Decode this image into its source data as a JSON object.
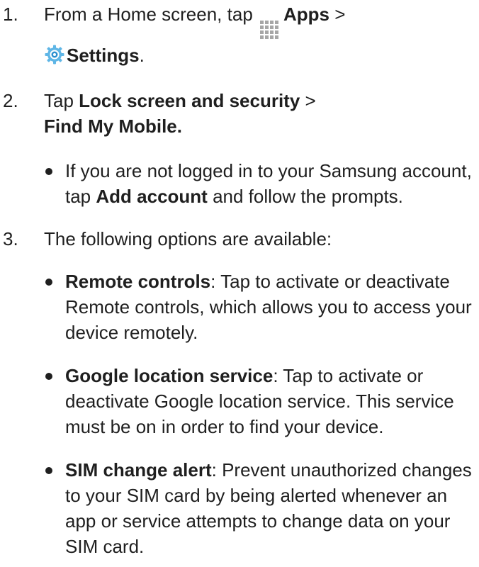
{
  "steps": [
    {
      "number": "1.",
      "text_prefix": "From a Home screen, tap",
      "apps_label": "Apps",
      "separator": ">",
      "settings_label": "Settings",
      "end": "."
    },
    {
      "number": "2.",
      "prefix": "Tap",
      "lock_label": "Lock screen and security",
      "separator": ">",
      "find_label": "Find My Mobile.",
      "bullets": [
        {
          "pre": "If you are not logged in to your Samsung account, tap",
          "bold": "Add account",
          "post": "and follow the prompts."
        }
      ]
    },
    {
      "number": "3.",
      "text": "The following options are available:",
      "bullets": [
        {
          "bold": "Remote controls",
          "post": ": Tap to activate or deactivate Remote controls, which allows you to access your device remotely."
        },
        {
          "bold": "Google location service",
          "post": ": Tap to activate or deactivate Google location service. This service must be on in order to find your device."
        },
        {
          "bold": "SIM change alert",
          "post": ": Prevent unauthorized changes to your SIM card by being alerted whenever an app or service attempts to change data on your SIM card."
        }
      ]
    }
  ],
  "icons": {
    "apps": "apps-grid-icon",
    "settings": "settings-gear-icon"
  },
  "colors": {
    "text": "#1f1f1f",
    "apps_icon": "#a6a6a6",
    "settings_icon_outer": "#5fb6e6",
    "settings_icon_inner": "#2a8fcf"
  }
}
